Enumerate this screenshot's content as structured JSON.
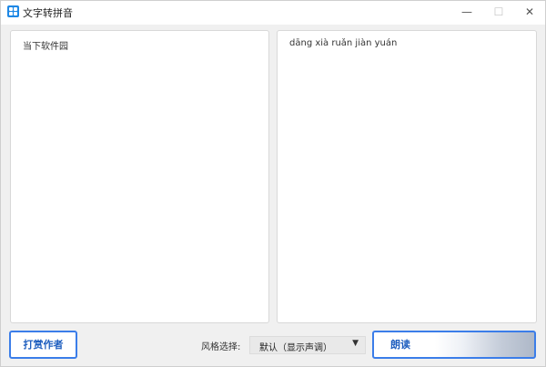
{
  "window": {
    "title": "文字转拼音",
    "minimize_glyph": "—",
    "maximize_glyph": "☐",
    "close_glyph": "✕"
  },
  "input_panel": {
    "text": "当下软件园"
  },
  "output_panel": {
    "text": "dāng xià ruǎn jiàn yuán"
  },
  "bottom": {
    "author_button": "打赏作者",
    "style_label": "风格选择:",
    "style_selected": "默认（显示声调）",
    "dropdown_glyph": "▼",
    "read_button": "朗读"
  },
  "colors": {
    "accent": "#3b7de9",
    "icon": "#1e88e5"
  },
  "icons": {
    "app": "app-grid-icon",
    "dropdown": "chevron-down-icon"
  }
}
